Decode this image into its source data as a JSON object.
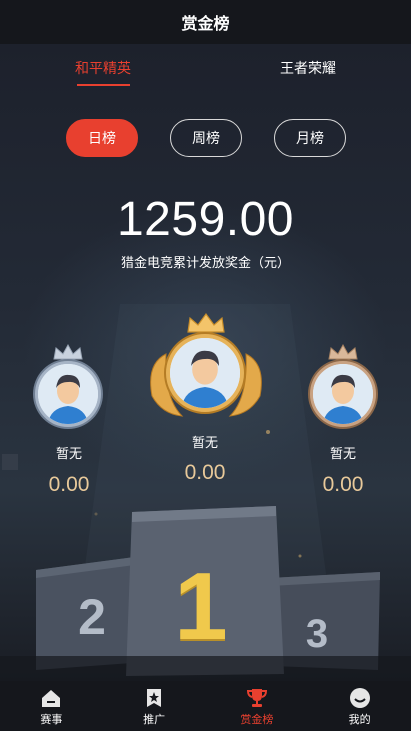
{
  "header": {
    "title": "赏金榜"
  },
  "game_tabs": [
    {
      "label": "和平精英",
      "active": true
    },
    {
      "label": "王者荣耀",
      "active": false
    }
  ],
  "periods": [
    {
      "label": "日榜",
      "active": true
    },
    {
      "label": "周榜",
      "active": false
    },
    {
      "label": "月榜",
      "active": false
    }
  ],
  "summary": {
    "total": "1259.00",
    "label": "猎金电竞累计发放奖金（元）"
  },
  "podium": {
    "first": {
      "name": "暂无",
      "score": "0.00",
      "rank": "1"
    },
    "second": {
      "name": "暂无",
      "score": "0.00",
      "rank": "2"
    },
    "third": {
      "name": "暂无",
      "score": "0.00",
      "rank": "3"
    }
  },
  "nav": [
    {
      "label": "赛事",
      "icon": "home-icon",
      "active": false
    },
    {
      "label": "推广",
      "icon": "star-badge-icon",
      "active": false
    },
    {
      "label": "赏金榜",
      "icon": "trophy-icon",
      "active": true
    },
    {
      "label": "我的",
      "icon": "smile-icon",
      "active": false
    }
  ],
  "colors": {
    "accent": "#e8402f",
    "gold": "#e8c99a",
    "background": "#1a1e28"
  }
}
